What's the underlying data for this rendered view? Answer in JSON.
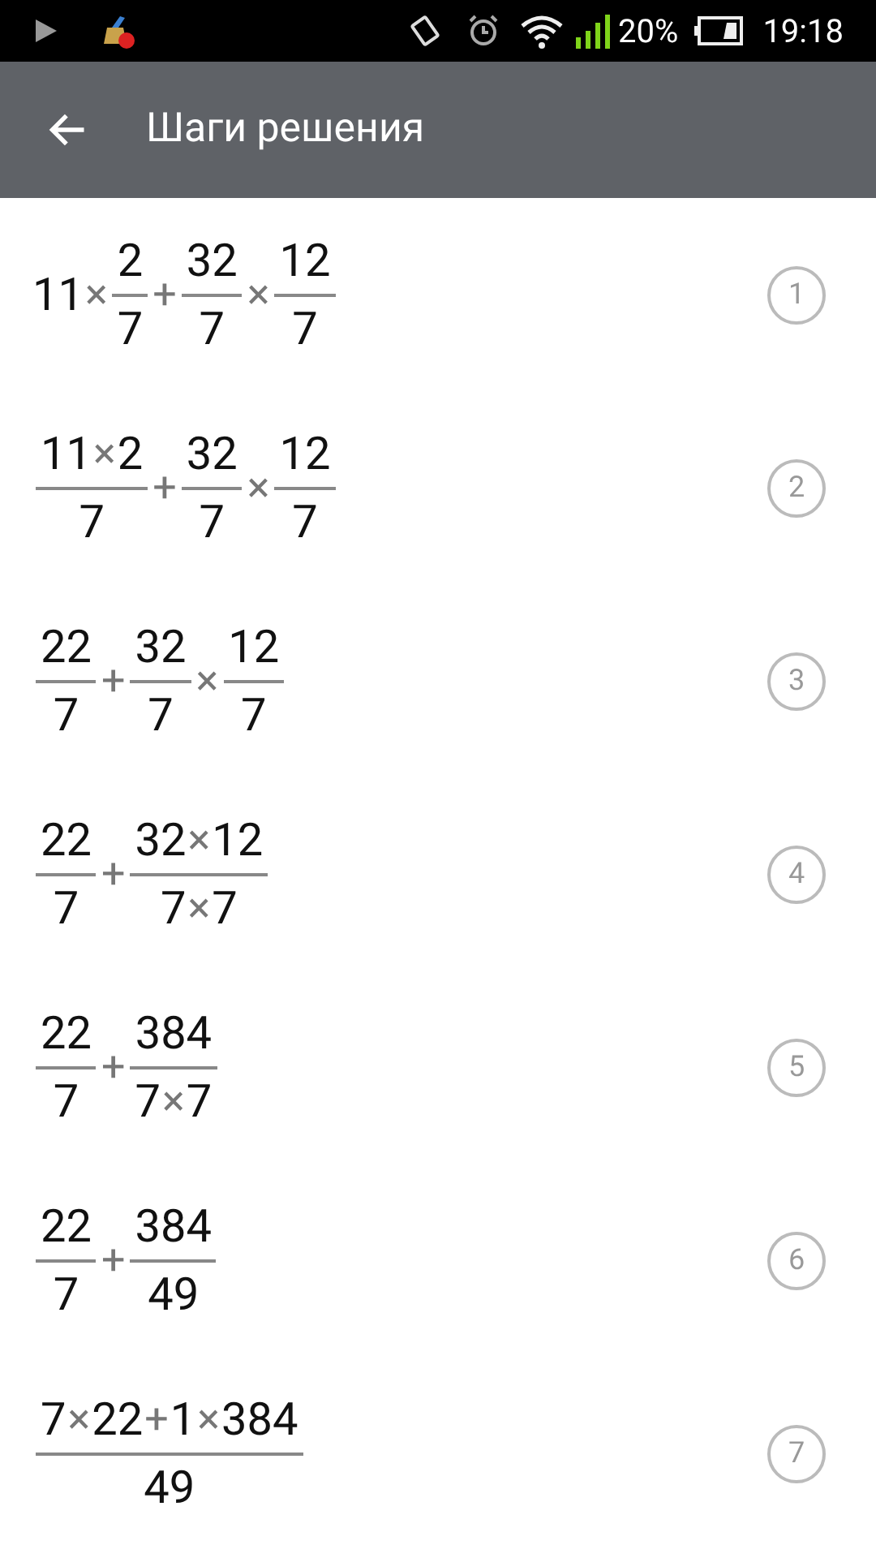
{
  "status_bar": {
    "battery": "20%",
    "time": "19:18"
  },
  "app_bar": {
    "title": "Шаги решения"
  },
  "steps": [
    {
      "number": "1",
      "expression": [
        {
          "kind": "number",
          "text": "11"
        },
        {
          "kind": "operator",
          "text": "×"
        },
        {
          "kind": "fraction",
          "numerator": [
            {
              "kind": "number",
              "text": "2"
            }
          ],
          "denominator": [
            {
              "kind": "number",
              "text": "7"
            }
          ]
        },
        {
          "kind": "operator",
          "text": "+"
        },
        {
          "kind": "fraction",
          "numerator": [
            {
              "kind": "number",
              "text": "32"
            }
          ],
          "denominator": [
            {
              "kind": "number",
              "text": "7"
            }
          ]
        },
        {
          "kind": "operator",
          "text": "×"
        },
        {
          "kind": "fraction",
          "numerator": [
            {
              "kind": "number",
              "text": "12"
            }
          ],
          "denominator": [
            {
              "kind": "number",
              "text": "7"
            }
          ]
        }
      ]
    },
    {
      "number": "2",
      "expression": [
        {
          "kind": "fraction",
          "numerator": [
            {
              "kind": "number",
              "text": "11"
            },
            {
              "kind": "operator",
              "text": "×"
            },
            {
              "kind": "number",
              "text": "2"
            }
          ],
          "denominator": [
            {
              "kind": "number",
              "text": "7"
            }
          ]
        },
        {
          "kind": "operator",
          "text": "+"
        },
        {
          "kind": "fraction",
          "numerator": [
            {
              "kind": "number",
              "text": "32"
            }
          ],
          "denominator": [
            {
              "kind": "number",
              "text": "7"
            }
          ]
        },
        {
          "kind": "operator",
          "text": "×"
        },
        {
          "kind": "fraction",
          "numerator": [
            {
              "kind": "number",
              "text": "12"
            }
          ],
          "denominator": [
            {
              "kind": "number",
              "text": "7"
            }
          ]
        }
      ]
    },
    {
      "number": "3",
      "expression": [
        {
          "kind": "fraction",
          "numerator": [
            {
              "kind": "number",
              "text": "22"
            }
          ],
          "denominator": [
            {
              "kind": "number",
              "text": "7"
            }
          ]
        },
        {
          "kind": "operator",
          "text": "+"
        },
        {
          "kind": "fraction",
          "numerator": [
            {
              "kind": "number",
              "text": "32"
            }
          ],
          "denominator": [
            {
              "kind": "number",
              "text": "7"
            }
          ]
        },
        {
          "kind": "operator",
          "text": "×"
        },
        {
          "kind": "fraction",
          "numerator": [
            {
              "kind": "number",
              "text": "12"
            }
          ],
          "denominator": [
            {
              "kind": "number",
              "text": "7"
            }
          ]
        }
      ]
    },
    {
      "number": "4",
      "expression": [
        {
          "kind": "fraction",
          "numerator": [
            {
              "kind": "number",
              "text": "22"
            }
          ],
          "denominator": [
            {
              "kind": "number",
              "text": "7"
            }
          ]
        },
        {
          "kind": "operator",
          "text": "+"
        },
        {
          "kind": "fraction",
          "numerator": [
            {
              "kind": "number",
              "text": "32"
            },
            {
              "kind": "operator",
              "text": "×"
            },
            {
              "kind": "number",
              "text": "12"
            }
          ],
          "denominator": [
            {
              "kind": "number",
              "text": "7"
            },
            {
              "kind": "operator",
              "text": "×"
            },
            {
              "kind": "number",
              "text": "7"
            }
          ]
        }
      ]
    },
    {
      "number": "5",
      "expression": [
        {
          "kind": "fraction",
          "numerator": [
            {
              "kind": "number",
              "text": "22"
            }
          ],
          "denominator": [
            {
              "kind": "number",
              "text": "7"
            }
          ]
        },
        {
          "kind": "operator",
          "text": "+"
        },
        {
          "kind": "fraction",
          "numerator": [
            {
              "kind": "number",
              "text": "384"
            }
          ],
          "denominator": [
            {
              "kind": "number",
              "text": "7"
            },
            {
              "kind": "operator",
              "text": "×"
            },
            {
              "kind": "number",
              "text": "7"
            }
          ]
        }
      ]
    },
    {
      "number": "6",
      "expression": [
        {
          "kind": "fraction",
          "numerator": [
            {
              "kind": "number",
              "text": "22"
            }
          ],
          "denominator": [
            {
              "kind": "number",
              "text": "7"
            }
          ]
        },
        {
          "kind": "operator",
          "text": "+"
        },
        {
          "kind": "fraction",
          "numerator": [
            {
              "kind": "number",
              "text": "384"
            }
          ],
          "denominator": [
            {
              "kind": "number",
              "text": "49"
            }
          ]
        }
      ]
    },
    {
      "number": "7",
      "expression": [
        {
          "kind": "fraction",
          "numerator": [
            {
              "kind": "number",
              "text": "7"
            },
            {
              "kind": "operator",
              "text": "×"
            },
            {
              "kind": "number",
              "text": "22"
            },
            {
              "kind": "operator",
              "text": "+"
            },
            {
              "kind": "number",
              "text": "1"
            },
            {
              "kind": "operator",
              "text": "×"
            },
            {
              "kind": "number",
              "text": "384"
            }
          ],
          "denominator": [
            {
              "kind": "number",
              "text": "49"
            }
          ]
        }
      ]
    }
  ]
}
